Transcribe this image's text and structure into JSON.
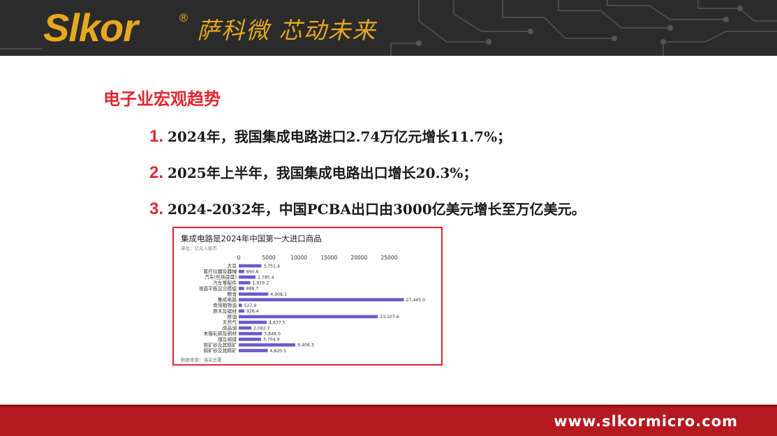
{
  "header": {
    "logo": "Slkor",
    "registered": "®",
    "slogan": "萨科微 芯动未来"
  },
  "section_title": "电子业宏观趋势",
  "items": [
    {
      "num": "1.",
      "text": "2024年，我国集成电路进口2.74万亿元增长11.7%；"
    },
    {
      "num": "2.",
      "text": "2025年上半年，我国集成电路出口增长20.3%；"
    },
    {
      "num": "3.",
      "text": "2024-2032年，中国PCBA出口由3000亿美元增长至万亿美元。"
    }
  ],
  "chart_data": {
    "type": "bar",
    "orientation": "horizontal",
    "title": "集成电路是2024年中国第一大进口商品",
    "subtitle": "单位：亿元人民币",
    "source": "数据来源：海关总署",
    "xlim": [
      0,
      27500
    ],
    "ticks": [
      0,
      5000,
      10000,
      15000,
      20000,
      25000
    ],
    "grid": false,
    "bar_color": "#6a5acd",
    "categories": [
      "大豆",
      "医疗仪器及器械",
      "汽车(包括底盘)",
      "汽车零配件",
      "液晶平板显示模组",
      "粮食",
      "集成电路",
      "食用植物油",
      "原木及锯材",
      "原油",
      "天然气",
      "成品油",
      "未锻轧铜及铜材",
      "煤及褐煤",
      "铁矿砂及其精矿",
      "铜矿砂及其精矿"
    ],
    "values": [
      3751.4,
      890.6,
      2785.4,
      1919.2,
      888.7,
      4908.1,
      27445.0,
      527.9,
      926.4,
      23107.6,
      4637.5,
      2082.7,
      3848.0,
      3704.9,
      9406.3,
      4820.5
    ],
    "value_labels": [
      "3,751.4",
      "890.6",
      "2,785.4",
      "1,919.2",
      "888.7",
      "4,908.1",
      "27,445.0",
      "527.9",
      "926.4",
      "23,107.6",
      "4,637.5",
      "2,082.7",
      "3,848.0",
      "3,704.9",
      "9,406.3",
      "4,820.5"
    ]
  },
  "footer": {
    "url": "www.slkormicro.com"
  }
}
